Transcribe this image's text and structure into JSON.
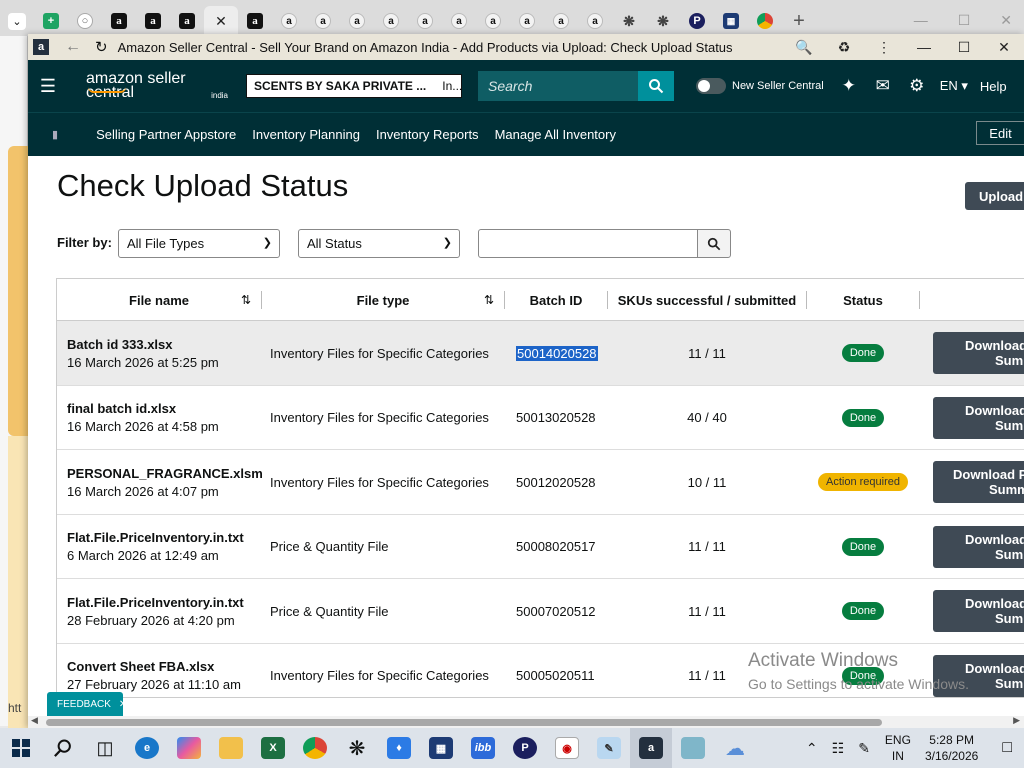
{
  "browser": {
    "tab_icons": [
      "chevron-down-icon",
      "sheets-icon",
      "web-icon",
      "amazon-icon",
      "amazon-icon",
      "amazon-icon",
      "close-icon",
      "amazon-icon",
      "amazon-icon",
      "amazon-icon",
      "amazon-icon",
      "amazon-icon",
      "amazon-icon",
      "amazon-icon",
      "amazon-icon",
      "amazon-icon",
      "amazon-icon",
      "amazon-icon",
      "chatgpt-icon",
      "chatgpt-icon",
      "p-icon",
      "qr-icon",
      "chrome-icon"
    ],
    "new_tab": "+",
    "window_title": "Amazon Seller Central - Sell Your Brand on Amazon India - Add Products via Upload: Check Upload Status"
  },
  "header": {
    "logo_main": "amazon seller central",
    "logo_sub": "india",
    "account_name": "SCENTS BY SAKA PRIVATE ...",
    "marketplace": "In...",
    "search_placeholder": "Search",
    "toggle_label": "New Seller Central",
    "language": "EN ▾",
    "help": "Help"
  },
  "nav": {
    "items": [
      "Selling Partner Appstore",
      "Inventory Planning",
      "Inventory Reports",
      "Manage All Inventory"
    ],
    "edit": "Edit"
  },
  "page": {
    "title": "Check Upload Status",
    "upload_button": "Upload",
    "filter_label": "Filter by:",
    "file_type_select": "All File Types",
    "status_select": "All Status",
    "filter_input_value": ""
  },
  "table": {
    "columns": [
      "File name",
      "File type",
      "Batch ID",
      "SKUs successful / submitted",
      "Status"
    ],
    "rows": [
      {
        "name": "Batch id 333.xlsx",
        "date": "16 March 2026 at 5:25 pm",
        "type": "Inventory Files for Specific Categories",
        "batch": "50014020528",
        "skus": "11 / 11",
        "status": "Done",
        "button": [
          "Download",
          "Sum"
        ]
      },
      {
        "name": "final batch id.xlsx",
        "date": "16 March 2026 at 4:58 pm",
        "type": "Inventory Files for Specific Categories",
        "batch": "50013020528",
        "skus": "40 / 40",
        "status": "Done",
        "button": [
          "Download",
          "Sum"
        ]
      },
      {
        "name": "PERSONAL_FRAGRANCE.xlsm",
        "date": "16 March 2026 at 4:07 pm",
        "type": "Inventory Files for Specific Categories",
        "batch": "50012020528",
        "skus": "10 / 11",
        "status": "Action required",
        "button": [
          "Download P",
          "Summ"
        ]
      },
      {
        "name": "Flat.File.PriceInventory.in.txt",
        "date": "6 March 2026 at 12:49 am",
        "type": "Price & Quantity File",
        "batch": "50008020517",
        "skus": "11 / 11",
        "status": "Done",
        "button": [
          "Download",
          "Sum"
        ]
      },
      {
        "name": "Flat.File.PriceInventory.in.txt",
        "date": "28 February 2026 at 4:20 pm",
        "type": "Price & Quantity File",
        "batch": "50007020512",
        "skus": "11 / 11",
        "status": "Done",
        "button": [
          "Download",
          "Sum"
        ]
      },
      {
        "name": "Convert Sheet FBA.xlsx",
        "date": "27 February 2026 at 11:10 am",
        "type": "Inventory Files for Specific Categories",
        "batch": "50005020511",
        "skus": "11 / 11",
        "status": "Done",
        "button": [
          "Download",
          "Sum"
        ]
      }
    ]
  },
  "feedback": "FEEDBACK",
  "watermark": {
    "line1": "Activate Windows",
    "line2": "Go to Settings to activate Windows."
  },
  "status_strip": "htt",
  "taskbar": {
    "lang_top": "ENG",
    "lang_bottom": "IN",
    "time": "5:28 PM",
    "date": "3/16/2026"
  }
}
